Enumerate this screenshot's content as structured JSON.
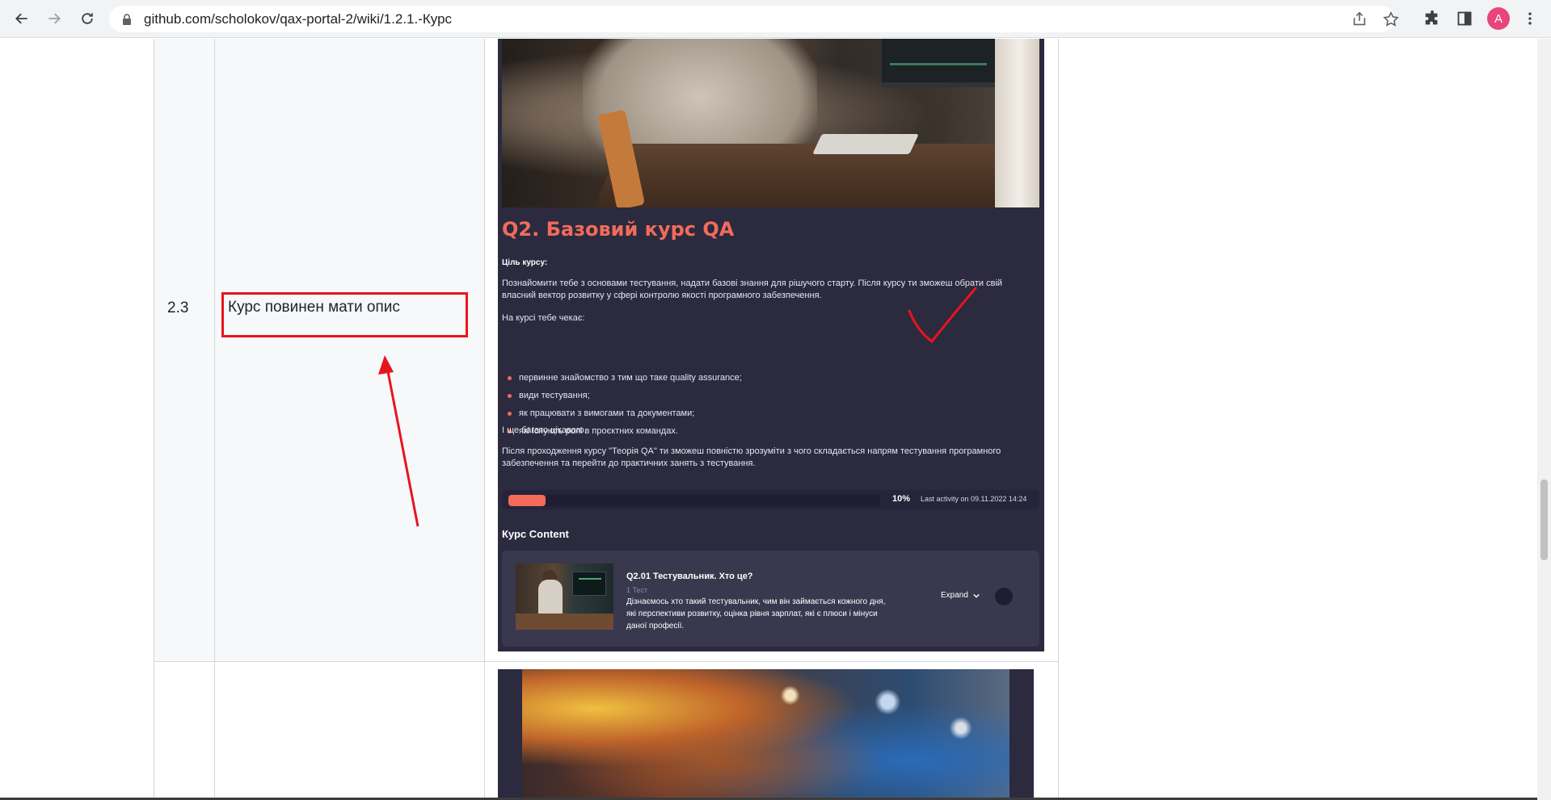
{
  "browser": {
    "url": "github.com/scholokov/qax-portal-2/wiki/1.2.1.-Курс",
    "avatar_letter": "A",
    "avatar_color": "#e8457a"
  },
  "table": {
    "row_number": "2.3",
    "requirement": "Курс повинен мати опис"
  },
  "course": {
    "title": "Q2. Базовий курс QA",
    "goal_label": "Ціль курсу:",
    "goal_text": "Познайомити тебе з основами тестування, надати базові знання для рішучого старту. Після курсу ти зможеш обрати свій власний вектор розвитку у сфері контролю якості програмного забезпечення.",
    "expect_label": "На курсі тебе чекає:",
    "bullets": [
      "первинне знайомство з тим що таке quality assurance;",
      "види тестування;",
      "як працювати з вимогами та документами;",
      "які існують ролі в проєктних командах."
    ],
    "more_text": "І ще багато цікавого.",
    "after_text": "Після проходження курсу \"Теорія QA\" ти зможеш повністю зрозуміти з чого складається напрям тестування програмного забезпечення та перейти до практичних занять з тестування.",
    "progress": {
      "percent_value": 0.1,
      "percent_label": "10%",
      "last_activity": "Last activity on 09.11.2022 14:24"
    },
    "content_title": "Курс Content",
    "lessons": [
      {
        "name": "Q2.01 Тестувальник. Хто це?",
        "meta": "1 Тест",
        "description": "Дізнаємось хто такий тестувальник, чим він займається кожного дня, які перспективи розвитку, оцінка рівня зарплат, які є плюси і мінуси даної професії.",
        "expand_label": "Expand"
      }
    ]
  },
  "colors": {
    "accent": "#f26b5b",
    "panel_bg": "#2b2a3f",
    "annotation_red": "#e8141d"
  }
}
